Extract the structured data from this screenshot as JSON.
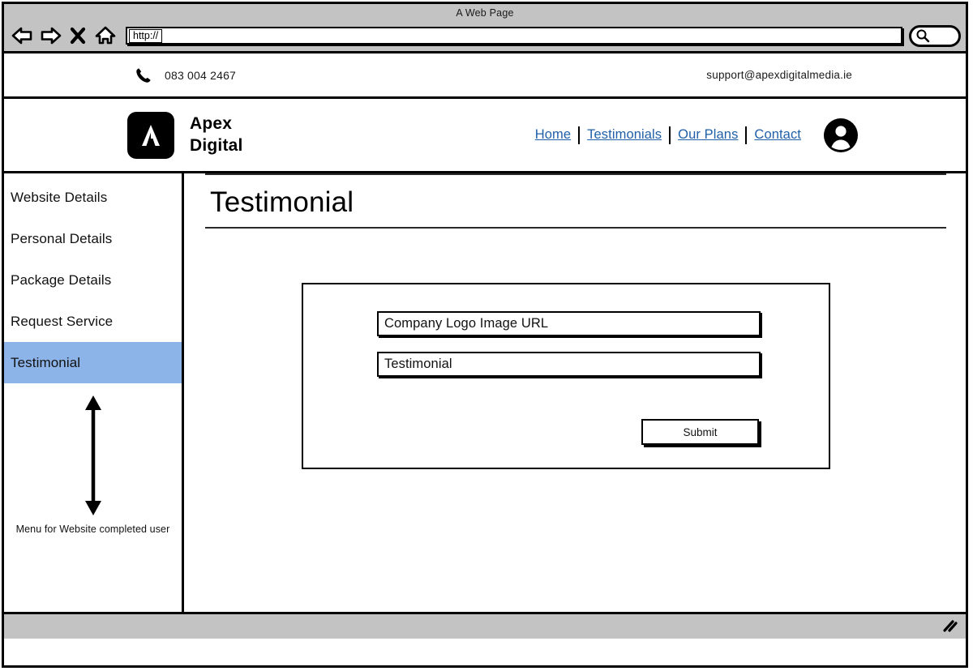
{
  "browser": {
    "window_title": "A Web Page",
    "url_value": "http://",
    "icons": {
      "back": "back-arrow-icon",
      "forward": "forward-arrow-icon",
      "stop": "stop-x-icon",
      "home": "home-icon",
      "search": "search-icon",
      "resize": "resize-grip-icon"
    }
  },
  "topbar": {
    "phone": "083 004 2467",
    "email": "support@apexdigitalmedia.ie",
    "phone_icon": "phone-icon"
  },
  "header": {
    "brand_line1": "Apex",
    "brand_line2": "Digital",
    "logo_letter": "A",
    "nav": [
      {
        "label": "Home"
      },
      {
        "label": "Testimonials"
      },
      {
        "label": "Our Plans"
      },
      {
        "label": "Contact"
      }
    ],
    "avatar_icon": "user-avatar-icon"
  },
  "sidebar": {
    "items": [
      {
        "label": "Website Details",
        "active": false
      },
      {
        "label": "Personal Details",
        "active": false
      },
      {
        "label": "Package Details",
        "active": false
      },
      {
        "label": "Request Service",
        "active": false
      },
      {
        "label": "Testimonial",
        "active": true
      }
    ],
    "annotation": {
      "caption": "Menu for Website completed user",
      "arrow_icon": "double-headed-vertical-arrow-icon"
    },
    "active_color": "#8db4e8"
  },
  "main": {
    "page_title": "Testimonial",
    "form": {
      "fields": [
        {
          "value": "Company Logo Image URL",
          "placeholder": "Company Logo Image URL"
        },
        {
          "value": "Testimonial",
          "placeholder": "Testimonial"
        }
      ],
      "submit_label": "Submit"
    }
  },
  "colors": {
    "link": "#1f5fa8",
    "highlight": "#8db4e8",
    "chrome": "#c3c3c3",
    "ink": "#000000"
  }
}
